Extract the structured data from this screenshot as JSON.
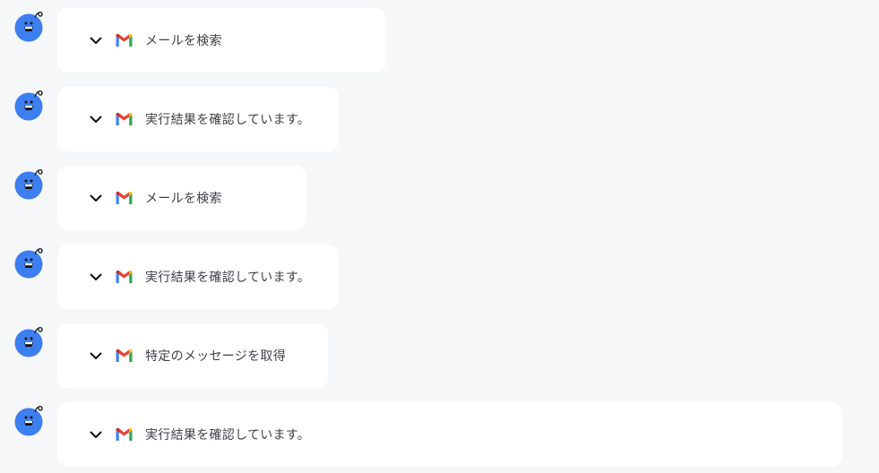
{
  "steps": [
    {
      "label": "メールを検索",
      "icon": "gmail-icon",
      "expanded": false
    },
    {
      "label": "実行結果を確認しています。",
      "icon": "gmail-icon",
      "expanded": false
    },
    {
      "label": "メールを検索",
      "icon": "gmail-icon",
      "expanded": false
    },
    {
      "label": "実行結果を確認しています。",
      "icon": "gmail-icon",
      "expanded": false
    },
    {
      "label": "特定のメッセージを取得",
      "icon": "gmail-icon",
      "expanded": false
    },
    {
      "label": "実行結果を確認しています。",
      "icon": "gmail-icon",
      "expanded": false
    }
  ],
  "colors": {
    "background": "#f6f7f9",
    "card": "#ffffff",
    "avatar": "#3d7ef0",
    "text": "#3c3f46"
  }
}
